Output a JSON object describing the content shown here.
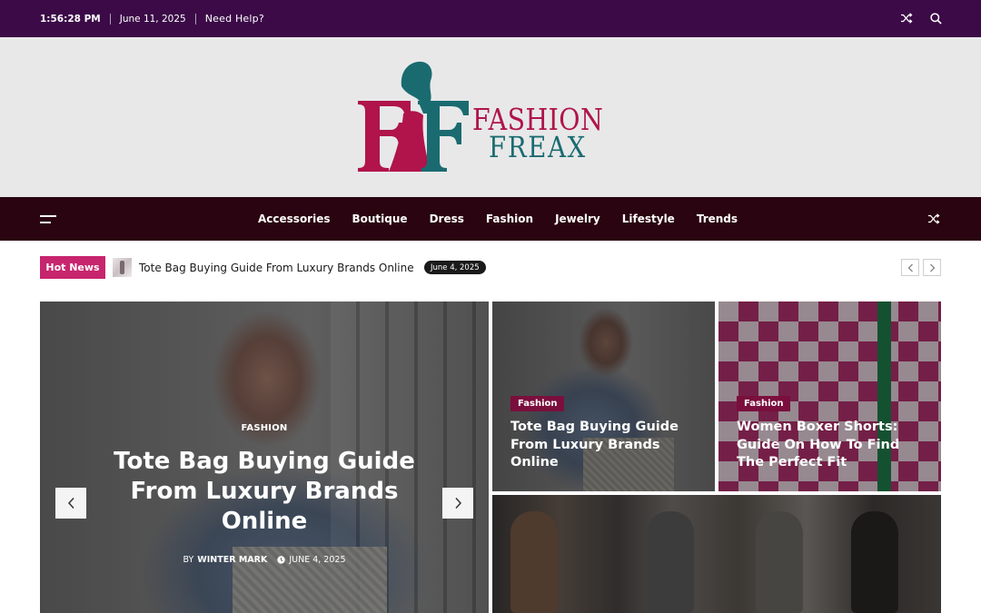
{
  "topbar": {
    "time": "1:56:28 PM",
    "date": "June 11, 2025",
    "help": "Need Help?",
    "icons": [
      "shuffle-icon",
      "search-icon"
    ]
  },
  "brand": {
    "line1": "FASHION",
    "line2": "FREAX",
    "colors": {
      "magenta": "#b0144a",
      "teal": "#1a6b70"
    }
  },
  "nav": {
    "items": [
      "Accessories",
      "Boutique",
      "Dress",
      "Fashion",
      "Jewelry",
      "Lifestyle",
      "Trends"
    ]
  },
  "ticker": {
    "label": "Hot News",
    "title": "Tote Bag Buying Guide From Luxury Brands Online",
    "date": "June 4, 2025"
  },
  "hero": {
    "category": "FASHION",
    "title": "Tote Bag Buying Guide From Luxury Brands Online",
    "by": "BY",
    "author": "WINTER MARK",
    "date": "JUNE 4, 2025"
  },
  "cards": [
    {
      "category": "Fashion",
      "title": "Tote Bag Buying Guide From Luxury Brands Online"
    },
    {
      "category": "Fashion",
      "title": "Women Boxer Shorts: Guide On How To Find The Perfect Fit"
    }
  ],
  "colors": {
    "topbar": "#3b0a47",
    "navbar": "#2a0410",
    "hot_label": "#c7256d",
    "category_tag": "#7a0f3d"
  }
}
